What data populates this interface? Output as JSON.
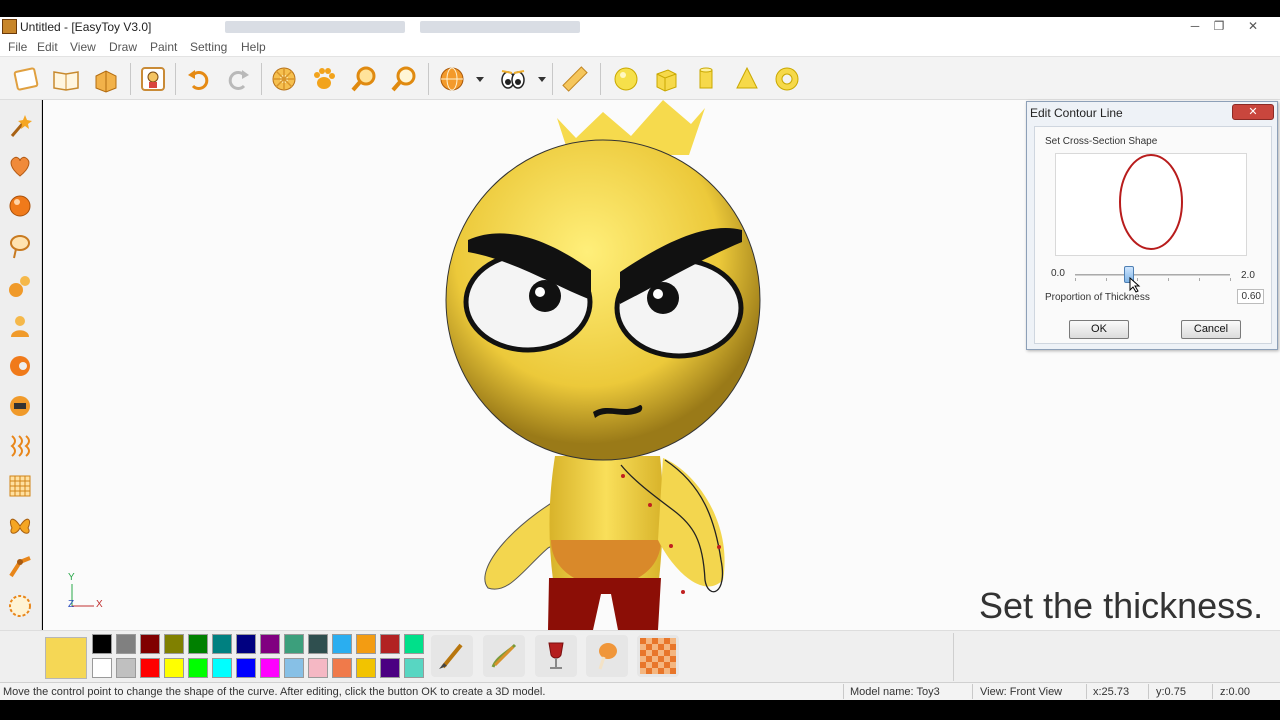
{
  "window": {
    "title": "Untitled - [EasyToy V3.0]",
    "controls": {
      "minimize": "─",
      "maximize": "❐",
      "close": "✕"
    }
  },
  "menu": [
    "File",
    "Edit",
    "View",
    "Draw",
    "Paint",
    "Setting",
    "Help"
  ],
  "toolbar": {
    "buttons": [
      "new-file-icon",
      "open-book-icon",
      "open-box-icon",
      "character-icon",
      "undo-icon",
      "redo-icon",
      "flower-stamp-icon",
      "paw-stamp-icon",
      "zoom-in-icon",
      "zoom-out-icon",
      "globe-view-icon",
      "eyes-icon",
      "ruler-icon",
      "sphere-icon",
      "cube-icon",
      "cylinder-icon",
      "cone-icon",
      "torus-icon"
    ]
  },
  "left_tools": [
    "magic-wand-icon",
    "heart-balloon-icon",
    "sphere-tool-icon",
    "lasso-icon",
    "joint-icon",
    "person-icon",
    "loop-icon",
    "bolt-icon",
    "spring-icon",
    "grid-icon",
    "butterfly-icon",
    "bend-icon",
    "contour-icon"
  ],
  "axes": {
    "y": "Y",
    "z": "Z",
    "x": "X"
  },
  "caption": "Set the thickness.",
  "dialog": {
    "title": "Edit Contour Line",
    "close": "✕",
    "section_label": "Set Cross-Section Shape",
    "slider_min": "0.0",
    "slider_max": "2.0",
    "slider_value_fraction": 0.35,
    "thickness_label": "Proportion of Thickness",
    "thickness_value": "0.60",
    "ok": "OK",
    "cancel": "Cancel"
  },
  "palette": {
    "current_color": "#f5d755",
    "top_row": [
      "#000000",
      "#808080",
      "#800000",
      "#808000",
      "#008000",
      "#008080",
      "#000080",
      "#800080",
      "#3c9f7c",
      "#2f4f4f",
      "#2aaef0",
      "#f39c12",
      "#b22222",
      "#00e08a"
    ],
    "bottom_row": [
      "#ffffff",
      "#c0c0c0",
      "#ff0000",
      "#ffff00",
      "#00ff00",
      "#00ffff",
      "#0000ff",
      "#ff00ff",
      "#87c0e6",
      "#f5b8c4",
      "#f07a4a",
      "#f2c300",
      "#4b0082",
      "#58d6c2"
    ],
    "tools": [
      "brush-icon",
      "pen-icon",
      "wine-glass-icon",
      "drumstick-icon",
      "checker-icon"
    ]
  },
  "status": {
    "hint": "Move the control point to change the shape of the curve. After editing, click the button OK to create a 3D model.",
    "model_name": "Model name:  Toy3",
    "view": "View: Front View",
    "x": "x:25.73",
    "y": "y:0.75",
    "z": "z:0.00"
  }
}
